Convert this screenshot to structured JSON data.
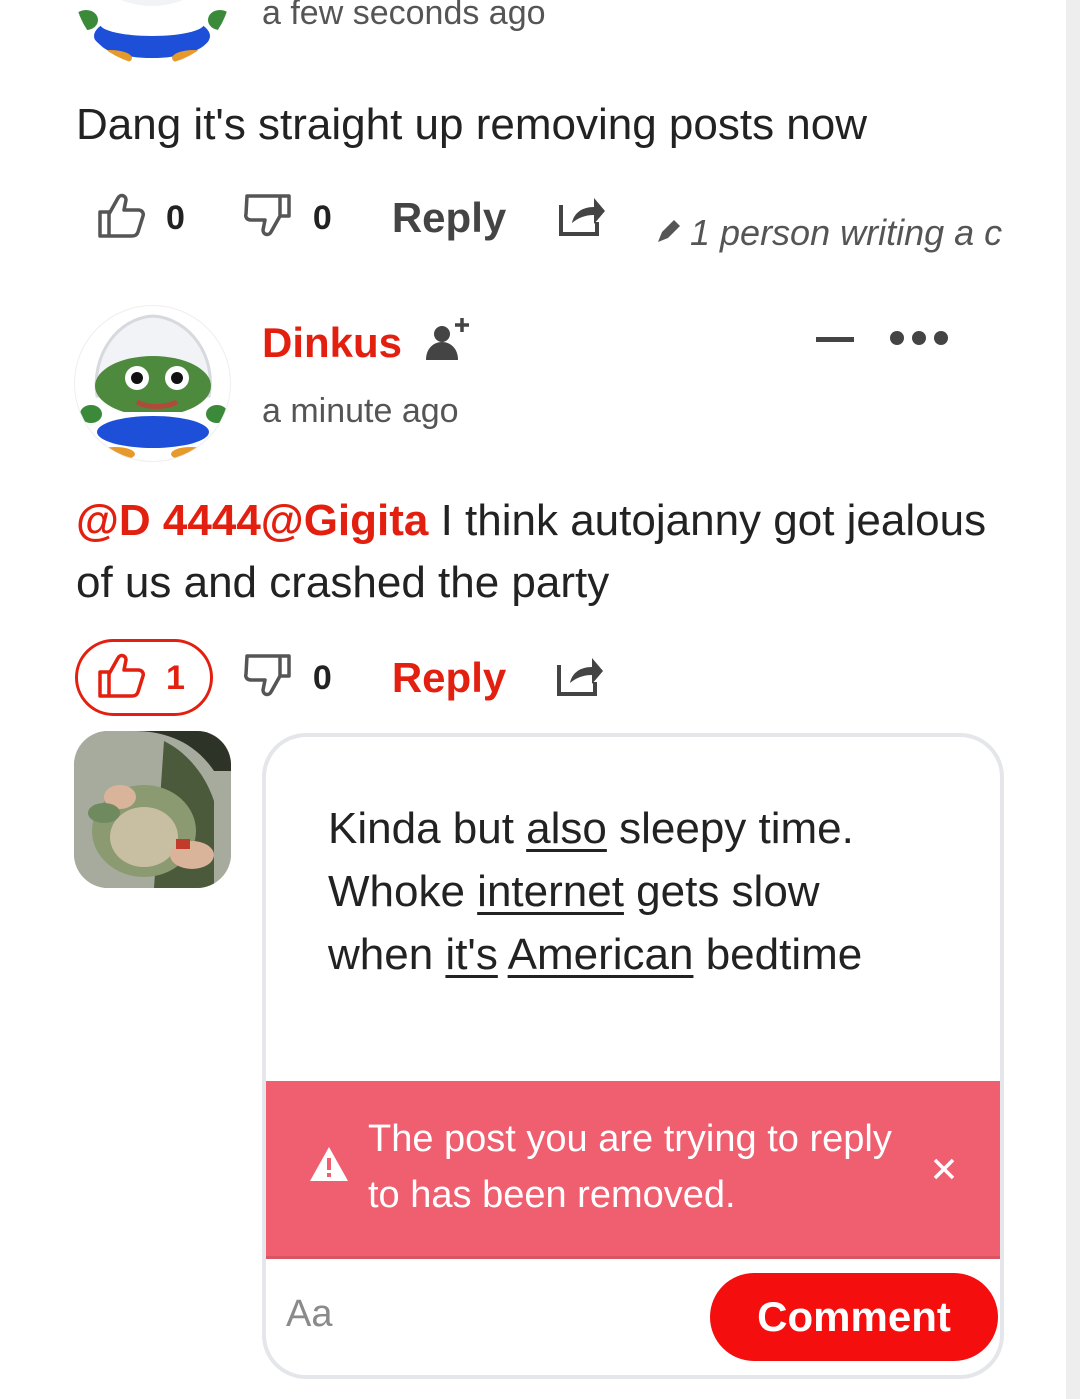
{
  "top_comment": {
    "timestamp": "a few seconds ago",
    "text": "Dang it's straight up removing posts now",
    "upvotes": "0",
    "downvotes": "0",
    "reply_label": "Reply",
    "writing_indicator": "1 person writing a c"
  },
  "dinkus_comment": {
    "username": "Dinkus",
    "timestamp": "a minute ago",
    "mention_1": "@D 4444",
    "mention_2": "@Gigita",
    "text_line_1": " I think autojanny got jealous",
    "text_line_2": "of us and crashed the party",
    "upvotes": "1",
    "downvotes": "0",
    "reply_label": "Reply"
  },
  "reply_composer": {
    "draft": {
      "w1": "Kinda but ",
      "w2": "also",
      "w3": " sleepy time.",
      "w4": "Whoke ",
      "w5": "internet",
      "w6": " gets slow",
      "w7": "when ",
      "w8": "it's",
      "w9": " ",
      "w10": "American",
      "w11": " bedtime"
    },
    "alert_text": "The post you are trying to reply to has been removed.",
    "input_placeholder": "Aa",
    "submit_label": "Comment"
  },
  "colors": {
    "accent": "#e31f0f",
    "button": "#f40e0e",
    "alert_bg": "#ef5f70"
  }
}
